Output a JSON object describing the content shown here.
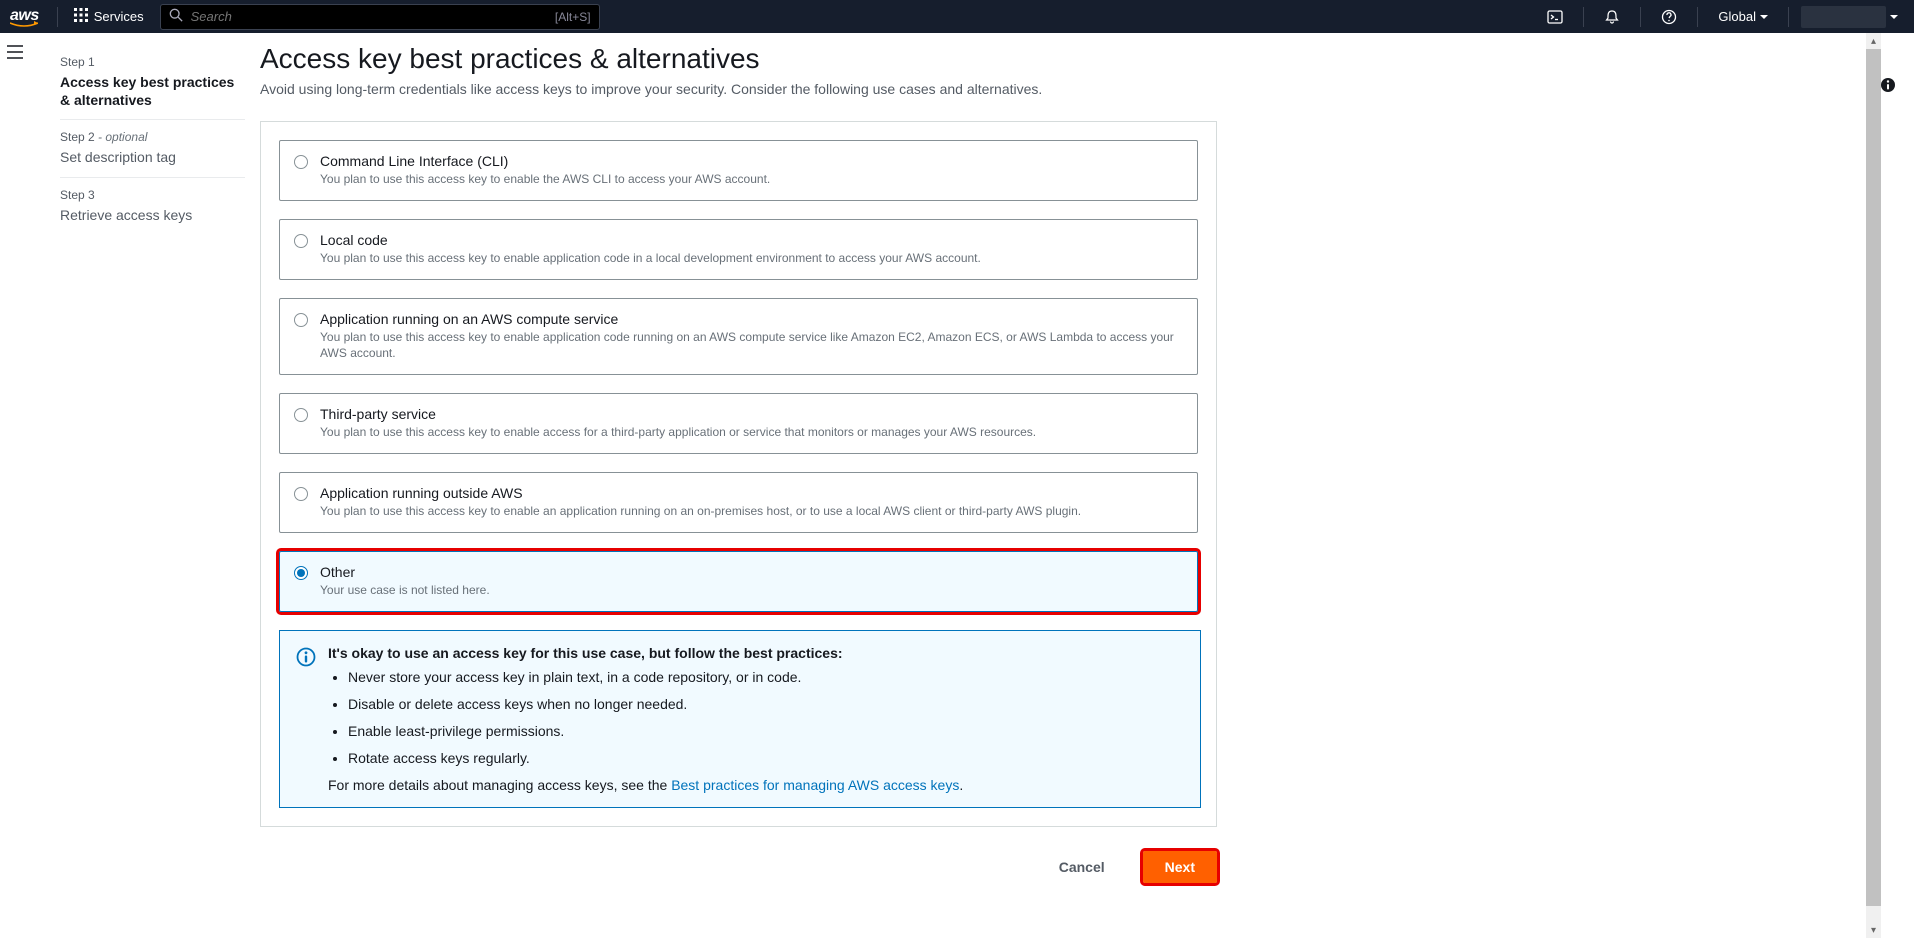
{
  "nav": {
    "logo": "aws",
    "services_label": "Services",
    "search_placeholder": "Search",
    "search_hint": "[Alt+S]",
    "region": "Global"
  },
  "steps": [
    {
      "label": "Step 1",
      "optional": "",
      "title": "Access key best practices & alternatives",
      "active": true
    },
    {
      "label": "Step 2",
      "optional": " - optional",
      "title": "Set description tag",
      "active": false
    },
    {
      "label": "Step 3",
      "optional": "",
      "title": "Retrieve access keys",
      "active": false
    }
  ],
  "page": {
    "title": "Access key best practices & alternatives",
    "subtitle": "Avoid using long-term credentials like access keys to improve your security. Consider the following use cases and alternatives."
  },
  "usecases": [
    {
      "title": "Command Line Interface (CLI)",
      "desc": "You plan to use this access key to enable the AWS CLI to access your AWS account.",
      "selected": false,
      "highlight": false
    },
    {
      "title": "Local code",
      "desc": "You plan to use this access key to enable application code in a local development environment to access your AWS account.",
      "selected": false,
      "highlight": false
    },
    {
      "title": "Application running on an AWS compute service",
      "desc": "You plan to use this access key to enable application code running on an AWS compute service like Amazon EC2, Amazon ECS, or AWS Lambda to access your AWS account.",
      "selected": false,
      "highlight": false
    },
    {
      "title": "Third-party service",
      "desc": "You plan to use this access key to enable access for a third-party application or service that monitors or manages your AWS resources.",
      "selected": false,
      "highlight": false
    },
    {
      "title": "Application running outside AWS",
      "desc": "You plan to use this access key to enable an application running on an on-premises host, or to use a local AWS client or third-party AWS plugin.",
      "selected": false,
      "highlight": false
    },
    {
      "title": "Other",
      "desc": "Your use case is not listed here.",
      "selected": true,
      "highlight": true
    }
  ],
  "info": {
    "heading": "It's okay to use an access key for this use case, but follow the best practices:",
    "bullets": [
      "Never store your access key in plain text, in a code repository, or in code.",
      "Disable or delete access keys when no longer needed.",
      "Enable least-privilege permissions.",
      "Rotate access keys regularly."
    ],
    "footer_prefix": "For more details about managing access keys, see the ",
    "footer_link": "Best practices for managing AWS access keys",
    "footer_suffix": "."
  },
  "actions": {
    "cancel": "Cancel",
    "next": "Next"
  }
}
